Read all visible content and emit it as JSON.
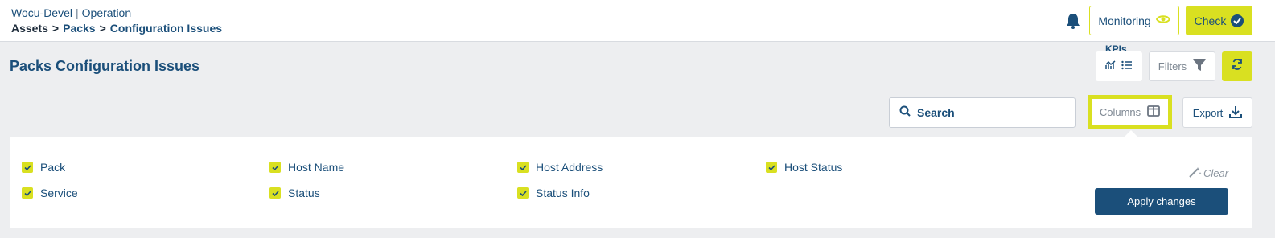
{
  "header": {
    "instance": "Wocu-Devel",
    "separator": "|",
    "section": "Operation",
    "breadcrumb": [
      "Assets",
      "Packs",
      "Configuration Issues"
    ],
    "breadcrumb_sep": ">",
    "monitoring_label": "Monitoring",
    "check_label": "Check"
  },
  "page": {
    "title": "Packs Configuration Issues",
    "kpis_label": "KPIs",
    "filters_label": "Filters"
  },
  "toolbar": {
    "search_placeholder": "Search",
    "columns_label": "Columns",
    "export_label": "Export"
  },
  "columns_panel": {
    "options": [
      {
        "label": "Pack",
        "checked": true
      },
      {
        "label": "Host Name",
        "checked": true
      },
      {
        "label": "Host Address",
        "checked": true
      },
      {
        "label": "Host Status",
        "checked": true
      },
      {
        "label": "Service",
        "checked": true
      },
      {
        "label": "Status",
        "checked": true
      },
      {
        "label": "Status Info",
        "checked": true
      }
    ],
    "clear_label": "Clear",
    "apply_label": "Apply changes"
  },
  "colors": {
    "accent": "#d9e021",
    "primary": "#1b4f7a",
    "background": "#edeef0"
  },
  "icons": [
    "bell-icon",
    "eye-icon",
    "check-circle-icon",
    "chart-icon",
    "list-icon",
    "filter-icon",
    "refresh-icon",
    "search-icon",
    "columns-icon",
    "download-icon",
    "magic-wand-icon",
    "checkbox-icon"
  ]
}
